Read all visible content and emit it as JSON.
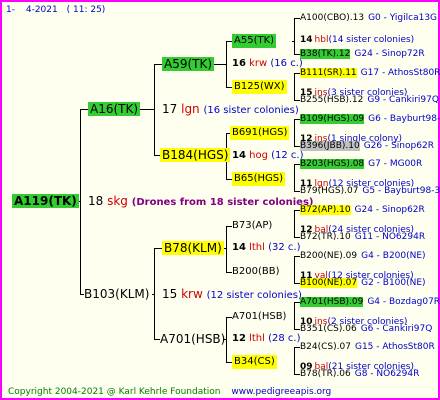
{
  "header": {
    "num": "1-",
    "date": "4-2021",
    "time": "( 11: 25)"
  },
  "footer": {
    "copyright": "Copyright 2004-2021 @ Karl Kehrle Foundation",
    "site": "www.pedigreeapis.org"
  },
  "root": {
    "name": "A119(TK)",
    "num": "18",
    "abbr": "skg",
    "note": "(Drones from 18 sister colonies)"
  },
  "gen1": [
    {
      "name": "A16(TK)"
    },
    {
      "name": "B103(KLM)",
      "num": "15",
      "abbr": "krw",
      "note": "(12 sister colonies)"
    }
  ],
  "gen2": [
    {
      "name": "A59(TK)"
    },
    {
      "name": "B184(HGS)",
      "num": "17",
      "abbr": "lgn",
      "note": "(16 sister colonies)"
    },
    {
      "name": "B78(KLM)"
    },
    {
      "name": "A701(HSB)"
    }
  ],
  "gen3": [
    {
      "name": "A55(TK)"
    },
    {
      "name": "B125(WX)",
      "num": "16",
      "abbr": "krw",
      "note": "(16 c.)"
    },
    {
      "name": "B691(HGS)"
    },
    {
      "name": "B65(HGS)",
      "num": "14",
      "abbr": "hog",
      "note": "(12 c.)"
    },
    {
      "name": "B73(AP)"
    },
    {
      "name": "B200(BB)",
      "num": "14",
      "abbr": "lthl",
      "note": "(32 c.)"
    },
    {
      "name": "A701(HSB)"
    },
    {
      "name": "B34(CS)",
      "num": "12",
      "abbr": "lthl",
      "note": "(28 c.)"
    }
  ],
  "gen4": [
    {
      "name": "A100(CBO).13",
      "info": "G0 - Yigilca13G"
    },
    {
      "num": "14",
      "abbr": "hbl",
      "note": "(14 sister colonies)"
    },
    {
      "name": "B38(TK).12",
      "info": "G24 - Sinop72R"
    },
    {
      "name": "B111(SR).11",
      "info": "G17 - AthosSt80R"
    },
    {
      "num": "15",
      "abbr": "ins",
      "note": "(3 sister colonies)"
    },
    {
      "name": "B255(HSB).12",
      "info": "G9 - Cankiri97Q"
    },
    {
      "name": "B109(HGS).09",
      "info": "G6 - Bayburt98-3"
    },
    {
      "num": "12",
      "abbr": "ins",
      "note": "(1 single colony)"
    },
    {
      "name": "B396(JBB).10",
      "info": "G26 - Sinop62R"
    },
    {
      "name": "B203(HGS).08",
      "info": "G7 - MG00R"
    },
    {
      "num": "11",
      "abbr": "lgn",
      "note": "(12 sister colonies)"
    },
    {
      "name": "B79(HGS).07",
      "info": "G5 - Bayburt98-3"
    },
    {
      "name": "B72(AP).10",
      "info": "G24 - Sinop62R"
    },
    {
      "num": "12",
      "abbr": "bal",
      "note": "(24 sister colonies)"
    },
    {
      "name": "B72(TR).10",
      "info": "G11 - NO6294R"
    },
    {
      "name": "B200(NE).09",
      "info": "G4 - B200(NE)"
    },
    {
      "num": "11",
      "abbr": "val",
      "note": "(12 sister colonies)"
    },
    {
      "name": "B100(NE).07",
      "info": "G2 - B100(NE)"
    },
    {
      "name": "A701(HSB).09",
      "info": "G4 - Bozdag07R"
    },
    {
      "num": "10",
      "abbr": "ins",
      "note": "(2 sister colonies)"
    },
    {
      "name": "B351(CS).06",
      "info": "G6 - Cankiri97Q"
    },
    {
      "name": "B24(CS).07",
      "info": "G15 - AthosSt80R"
    },
    {
      "num": "09",
      "abbr": "bal",
      "note": "(21 sister colonies)"
    },
    {
      "name": "B78(TR).06",
      "info": "G8 - NO6294R"
    }
  ]
}
